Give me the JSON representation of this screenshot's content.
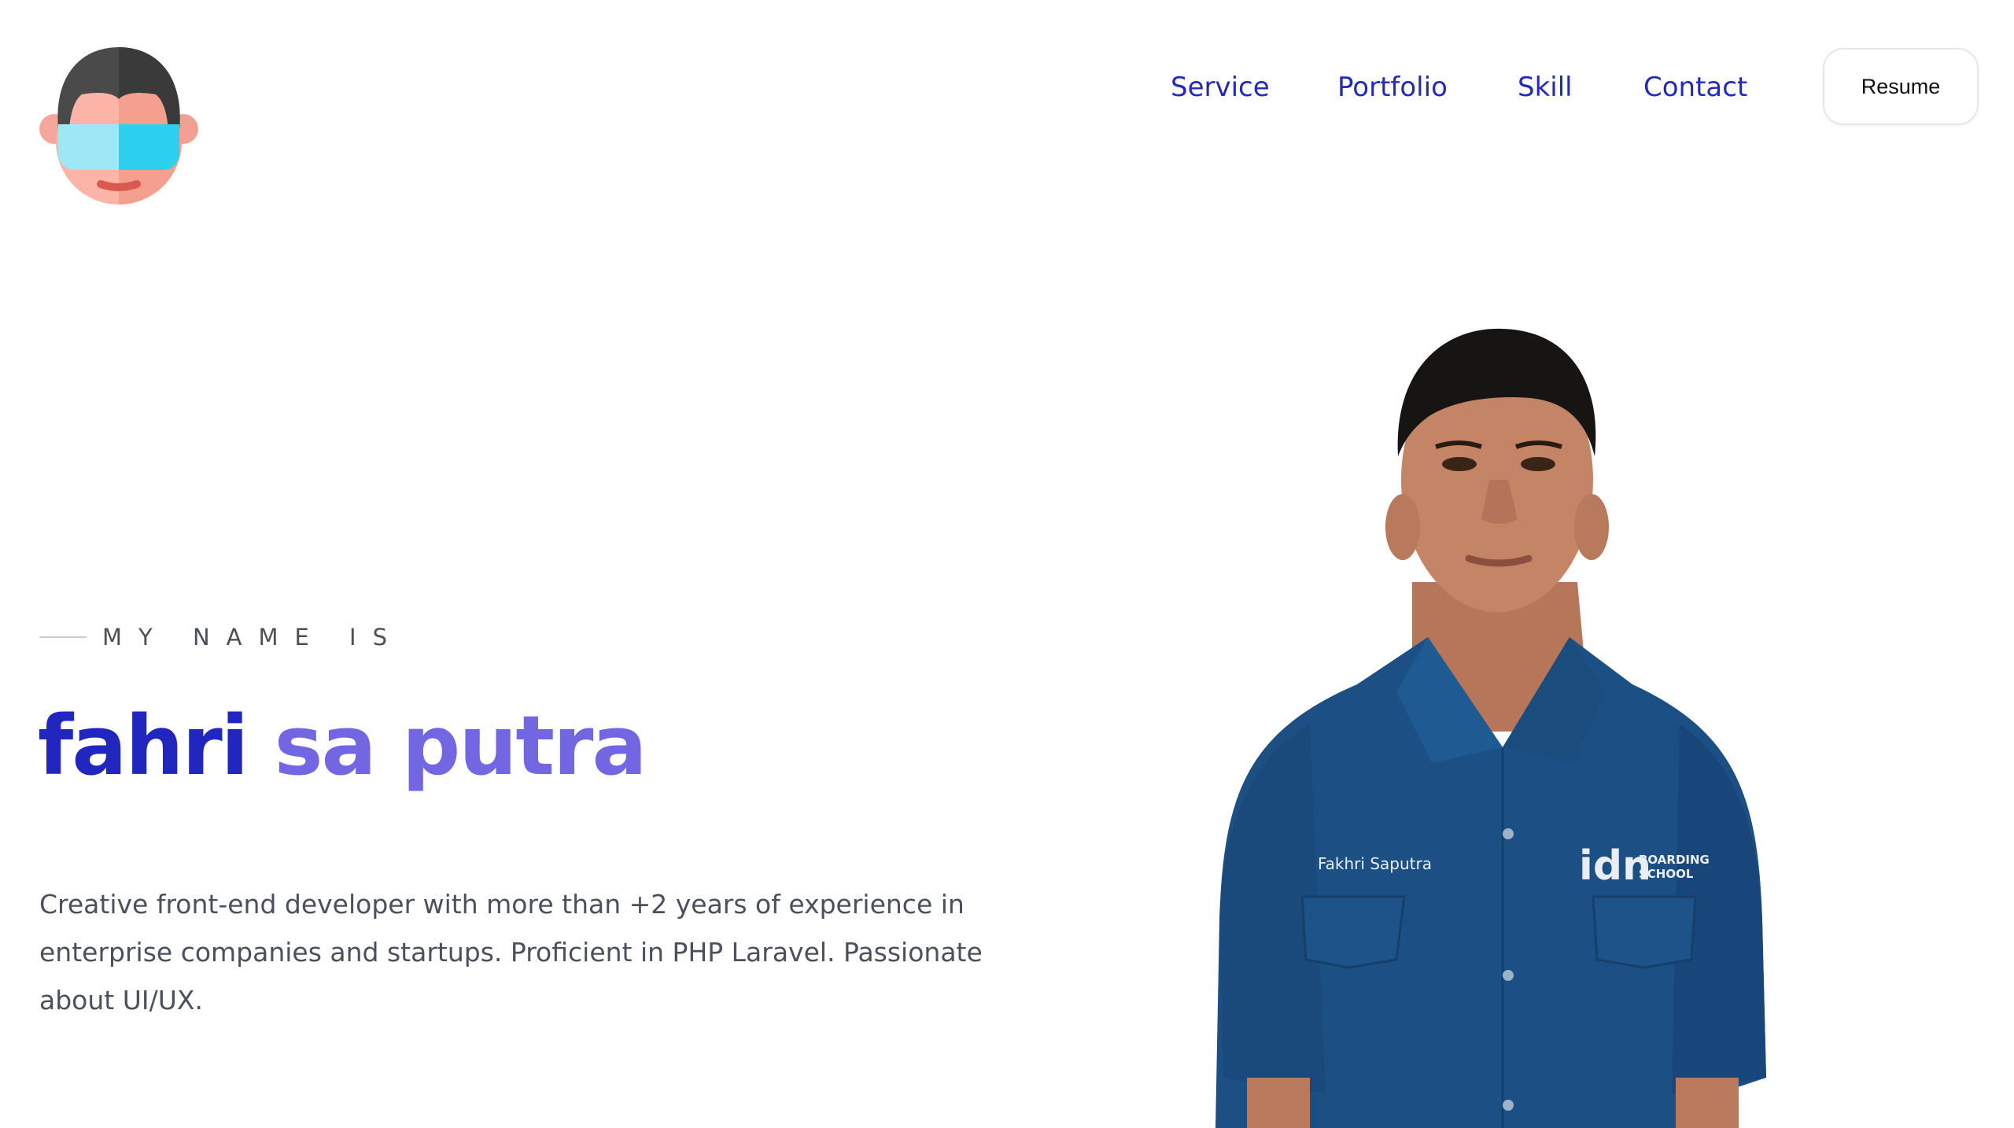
{
  "header": {
    "nav": [
      {
        "label": "Service"
      },
      {
        "label": "Portfolio"
      },
      {
        "label": "Skill"
      },
      {
        "label": "Contact"
      }
    ],
    "resume_label": "Resume"
  },
  "hero": {
    "eyebrow": "MY NAME IS",
    "name_first": "fahri",
    "name_rest": " sa putra",
    "description": "Creative front-end developer with more than +2 years of experience in enterprise companies and startups. Proficient in PHP Laravel. Passionate about UI/UX."
  },
  "portrait": {
    "shirt_name": "Fakhri Saputra",
    "shirt_logo": "idn",
    "shirt_logo_text_1": "BOARDING",
    "shirt_logo_text_2": "SCHOOL"
  },
  "colors": {
    "nav": "#2329b8",
    "name_primary": "#2126bf",
    "name_secondary": "#7366e2",
    "body_text": "#4a505c",
    "shirt": "#1c4f84"
  },
  "icons": {
    "logo": "avatar-with-visor-icon"
  }
}
